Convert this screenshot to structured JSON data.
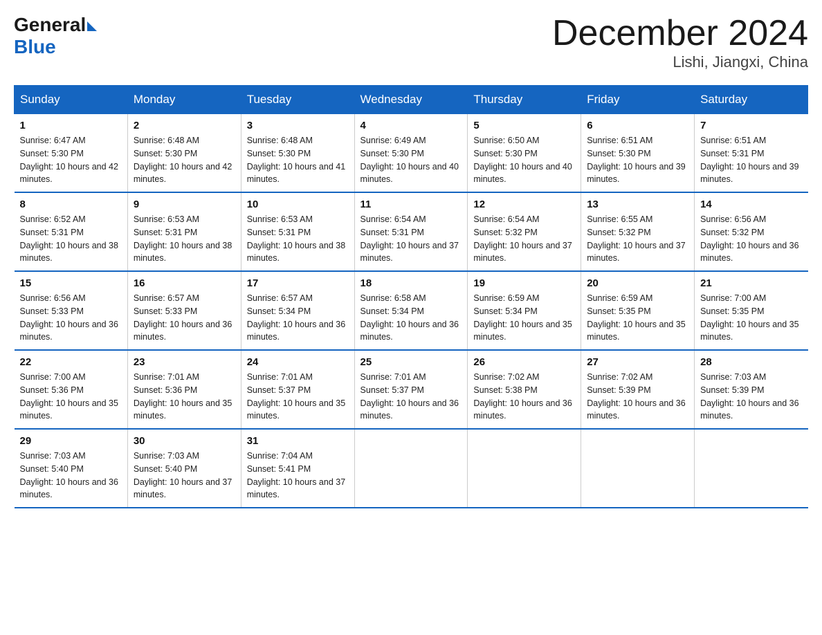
{
  "header": {
    "logo_general": "General",
    "logo_blue": "Blue",
    "month_title": "December 2024",
    "location": "Lishi, Jiangxi, China"
  },
  "weekdays": [
    "Sunday",
    "Monday",
    "Tuesday",
    "Wednesday",
    "Thursday",
    "Friday",
    "Saturday"
  ],
  "weeks": [
    [
      {
        "day": "1",
        "sunrise": "6:47 AM",
        "sunset": "5:30 PM",
        "daylight": "10 hours and 42 minutes."
      },
      {
        "day": "2",
        "sunrise": "6:48 AM",
        "sunset": "5:30 PM",
        "daylight": "10 hours and 42 minutes."
      },
      {
        "day": "3",
        "sunrise": "6:48 AM",
        "sunset": "5:30 PM",
        "daylight": "10 hours and 41 minutes."
      },
      {
        "day": "4",
        "sunrise": "6:49 AM",
        "sunset": "5:30 PM",
        "daylight": "10 hours and 40 minutes."
      },
      {
        "day": "5",
        "sunrise": "6:50 AM",
        "sunset": "5:30 PM",
        "daylight": "10 hours and 40 minutes."
      },
      {
        "day": "6",
        "sunrise": "6:51 AM",
        "sunset": "5:30 PM",
        "daylight": "10 hours and 39 minutes."
      },
      {
        "day": "7",
        "sunrise": "6:51 AM",
        "sunset": "5:31 PM",
        "daylight": "10 hours and 39 minutes."
      }
    ],
    [
      {
        "day": "8",
        "sunrise": "6:52 AM",
        "sunset": "5:31 PM",
        "daylight": "10 hours and 38 minutes."
      },
      {
        "day": "9",
        "sunrise": "6:53 AM",
        "sunset": "5:31 PM",
        "daylight": "10 hours and 38 minutes."
      },
      {
        "day": "10",
        "sunrise": "6:53 AM",
        "sunset": "5:31 PM",
        "daylight": "10 hours and 38 minutes."
      },
      {
        "day": "11",
        "sunrise": "6:54 AM",
        "sunset": "5:31 PM",
        "daylight": "10 hours and 37 minutes."
      },
      {
        "day": "12",
        "sunrise": "6:54 AM",
        "sunset": "5:32 PM",
        "daylight": "10 hours and 37 minutes."
      },
      {
        "day": "13",
        "sunrise": "6:55 AM",
        "sunset": "5:32 PM",
        "daylight": "10 hours and 37 minutes."
      },
      {
        "day": "14",
        "sunrise": "6:56 AM",
        "sunset": "5:32 PM",
        "daylight": "10 hours and 36 minutes."
      }
    ],
    [
      {
        "day": "15",
        "sunrise": "6:56 AM",
        "sunset": "5:33 PM",
        "daylight": "10 hours and 36 minutes."
      },
      {
        "day": "16",
        "sunrise": "6:57 AM",
        "sunset": "5:33 PM",
        "daylight": "10 hours and 36 minutes."
      },
      {
        "day": "17",
        "sunrise": "6:57 AM",
        "sunset": "5:34 PM",
        "daylight": "10 hours and 36 minutes."
      },
      {
        "day": "18",
        "sunrise": "6:58 AM",
        "sunset": "5:34 PM",
        "daylight": "10 hours and 36 minutes."
      },
      {
        "day": "19",
        "sunrise": "6:59 AM",
        "sunset": "5:34 PM",
        "daylight": "10 hours and 35 minutes."
      },
      {
        "day": "20",
        "sunrise": "6:59 AM",
        "sunset": "5:35 PM",
        "daylight": "10 hours and 35 minutes."
      },
      {
        "day": "21",
        "sunrise": "7:00 AM",
        "sunset": "5:35 PM",
        "daylight": "10 hours and 35 minutes."
      }
    ],
    [
      {
        "day": "22",
        "sunrise": "7:00 AM",
        "sunset": "5:36 PM",
        "daylight": "10 hours and 35 minutes."
      },
      {
        "day": "23",
        "sunrise": "7:01 AM",
        "sunset": "5:36 PM",
        "daylight": "10 hours and 35 minutes."
      },
      {
        "day": "24",
        "sunrise": "7:01 AM",
        "sunset": "5:37 PM",
        "daylight": "10 hours and 35 minutes."
      },
      {
        "day": "25",
        "sunrise": "7:01 AM",
        "sunset": "5:37 PM",
        "daylight": "10 hours and 36 minutes."
      },
      {
        "day": "26",
        "sunrise": "7:02 AM",
        "sunset": "5:38 PM",
        "daylight": "10 hours and 36 minutes."
      },
      {
        "day": "27",
        "sunrise": "7:02 AM",
        "sunset": "5:39 PM",
        "daylight": "10 hours and 36 minutes."
      },
      {
        "day": "28",
        "sunrise": "7:03 AM",
        "sunset": "5:39 PM",
        "daylight": "10 hours and 36 minutes."
      }
    ],
    [
      {
        "day": "29",
        "sunrise": "7:03 AM",
        "sunset": "5:40 PM",
        "daylight": "10 hours and 36 minutes."
      },
      {
        "day": "30",
        "sunrise": "7:03 AM",
        "sunset": "5:40 PM",
        "daylight": "10 hours and 37 minutes."
      },
      {
        "day": "31",
        "sunrise": "7:04 AM",
        "sunset": "5:41 PM",
        "daylight": "10 hours and 37 minutes."
      },
      null,
      null,
      null,
      null
    ]
  ]
}
